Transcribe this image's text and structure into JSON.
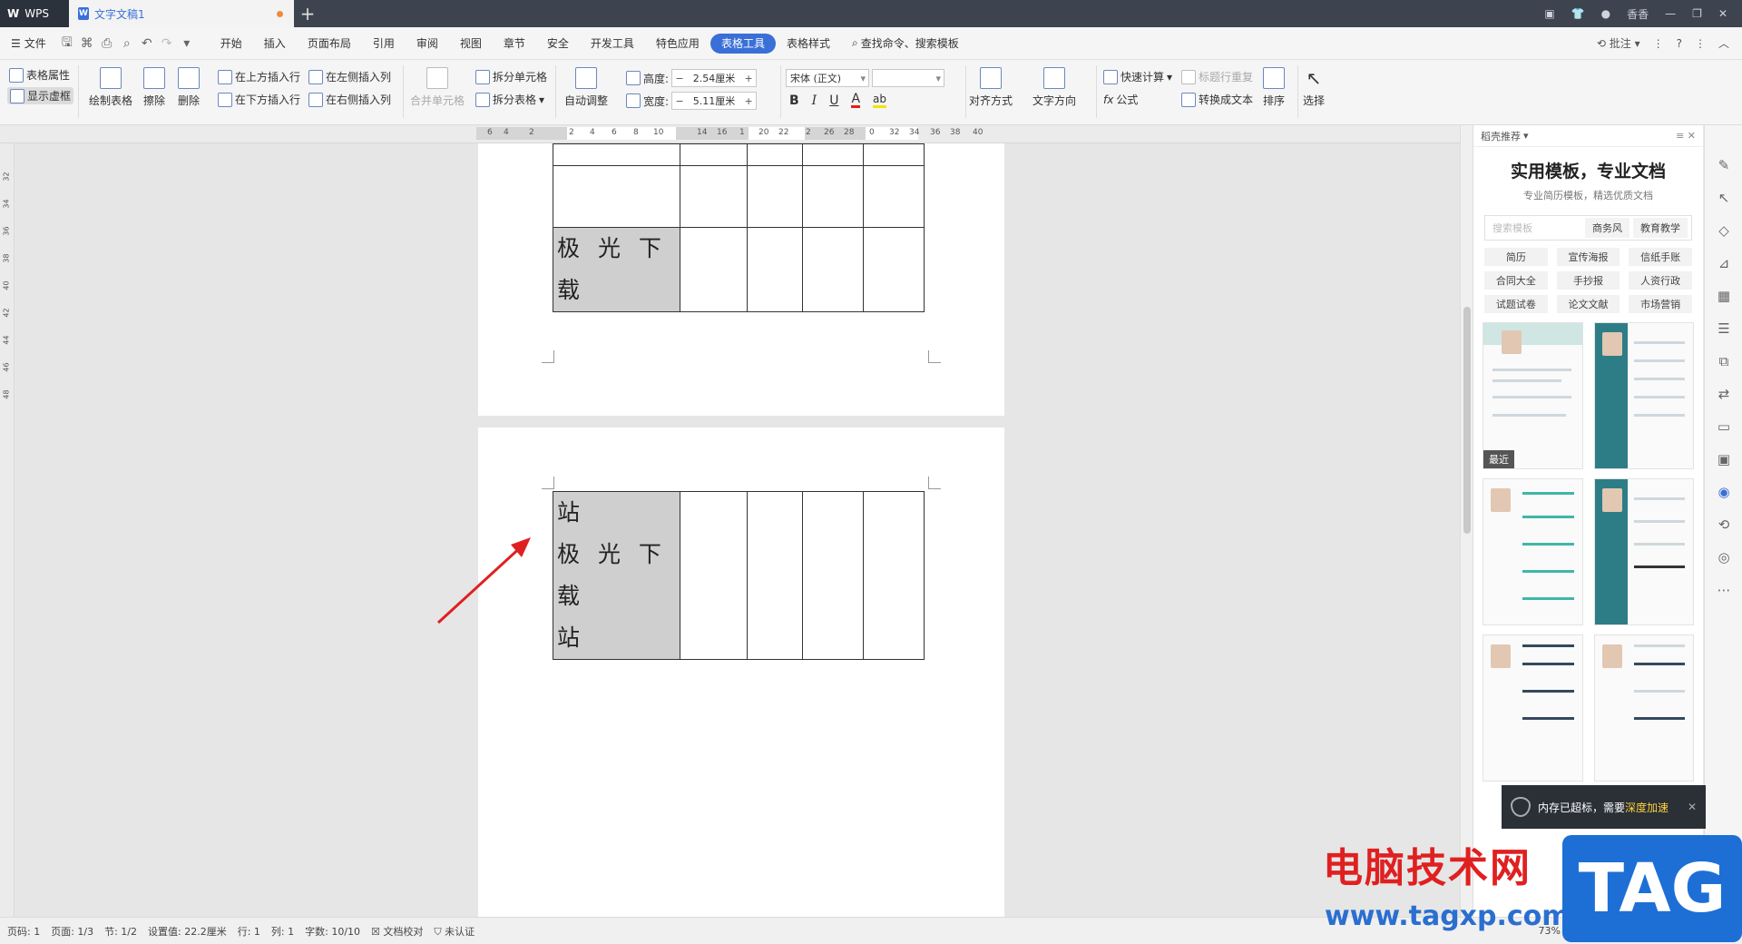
{
  "titlebar": {
    "app_name": "WPS",
    "tab_title": "文字文稿1",
    "user": "香香"
  },
  "menu": {
    "file": "文件",
    "items": [
      "开始",
      "插入",
      "页面布局",
      "引用",
      "审阅",
      "视图",
      "章节",
      "安全",
      "开发工具",
      "特色应用",
      "表格工具",
      "表格样式"
    ],
    "active": "表格工具",
    "search": "查找命令、搜索模板",
    "annotate": "批注"
  },
  "ribbon": {
    "table_props": "表格属性",
    "show_grid": "显示虚框",
    "draw_table": "绘制表格",
    "erase": "擦除",
    "delete": "删除",
    "insert_above": "在上方插入行",
    "insert_below": "在下方插入行",
    "insert_left": "在左侧插入列",
    "insert_right": "在右侧插入列",
    "merge_cells": "合并单元格",
    "split_cells": "拆分单元格",
    "split_table": "拆分表格",
    "auto_fit": "自动调整",
    "height_label": "高度:",
    "height_value": "2.54厘米",
    "width_label": "宽度:",
    "width_value": "5.11厘米",
    "font_name": "宋体 (正文)",
    "font_size": "",
    "align": "对齐方式",
    "text_dir": "文字方向",
    "quick_calc": "快速计算",
    "repeat_header": "标题行重复",
    "formula": "公式",
    "to_text": "转换成文本",
    "sort": "排序",
    "select": "选择"
  },
  "ruler": {
    "h_numbers": [
      "6",
      "4",
      "2",
      "2",
      "4",
      "6",
      "8",
      "10",
      "14",
      "16",
      "1",
      "20",
      "22",
      "2",
      "26",
      "28",
      "0",
      "32",
      "34",
      "36",
      "38",
      "40"
    ],
    "v_numbers": [
      "32",
      "34",
      "36",
      "38",
      "40",
      "42",
      "44",
      "46",
      "48"
    ]
  },
  "document": {
    "page1_cell_text": "极 光 下 载",
    "page2_cell_lines": [
      "站",
      "极 光 下 载",
      "站"
    ]
  },
  "panel": {
    "header": "稻壳推荐",
    "title": "实用模板，专业文档",
    "subtitle": "专业简历模板，精选优质文档",
    "search_placeholder": "搜索模板",
    "search_tags": [
      "商务风",
      "教育教学"
    ],
    "categories": [
      "简历",
      "宣传海报",
      "信纸手账",
      "合同大全",
      "手抄报",
      "人资行政",
      "试题试卷",
      "论文文献",
      "市场营销"
    ],
    "recent_label": "最近"
  },
  "notification": {
    "text_prefix": "内存已超标，需要",
    "text_highlight": "深度加速"
  },
  "statusbar": {
    "page_code": "页码: 1",
    "page": "页面: 1/3",
    "section": "节: 1/2",
    "setting": "设置值: 22.2厘米",
    "row": "行: 1",
    "col": "列: 1",
    "word_count": "字数: 10/10",
    "proofread": "文档校对",
    "cert": "未认证",
    "zoom": "73%"
  },
  "watermark": {
    "cn": "电脑技术网",
    "url": "www.tagxp.com",
    "tag": "TAG"
  },
  "colors": {
    "accent": "#3a6fd8",
    "titlebar": "#3d4450",
    "arrow": "#e02020",
    "grey_cell": "#cfcfcf"
  }
}
